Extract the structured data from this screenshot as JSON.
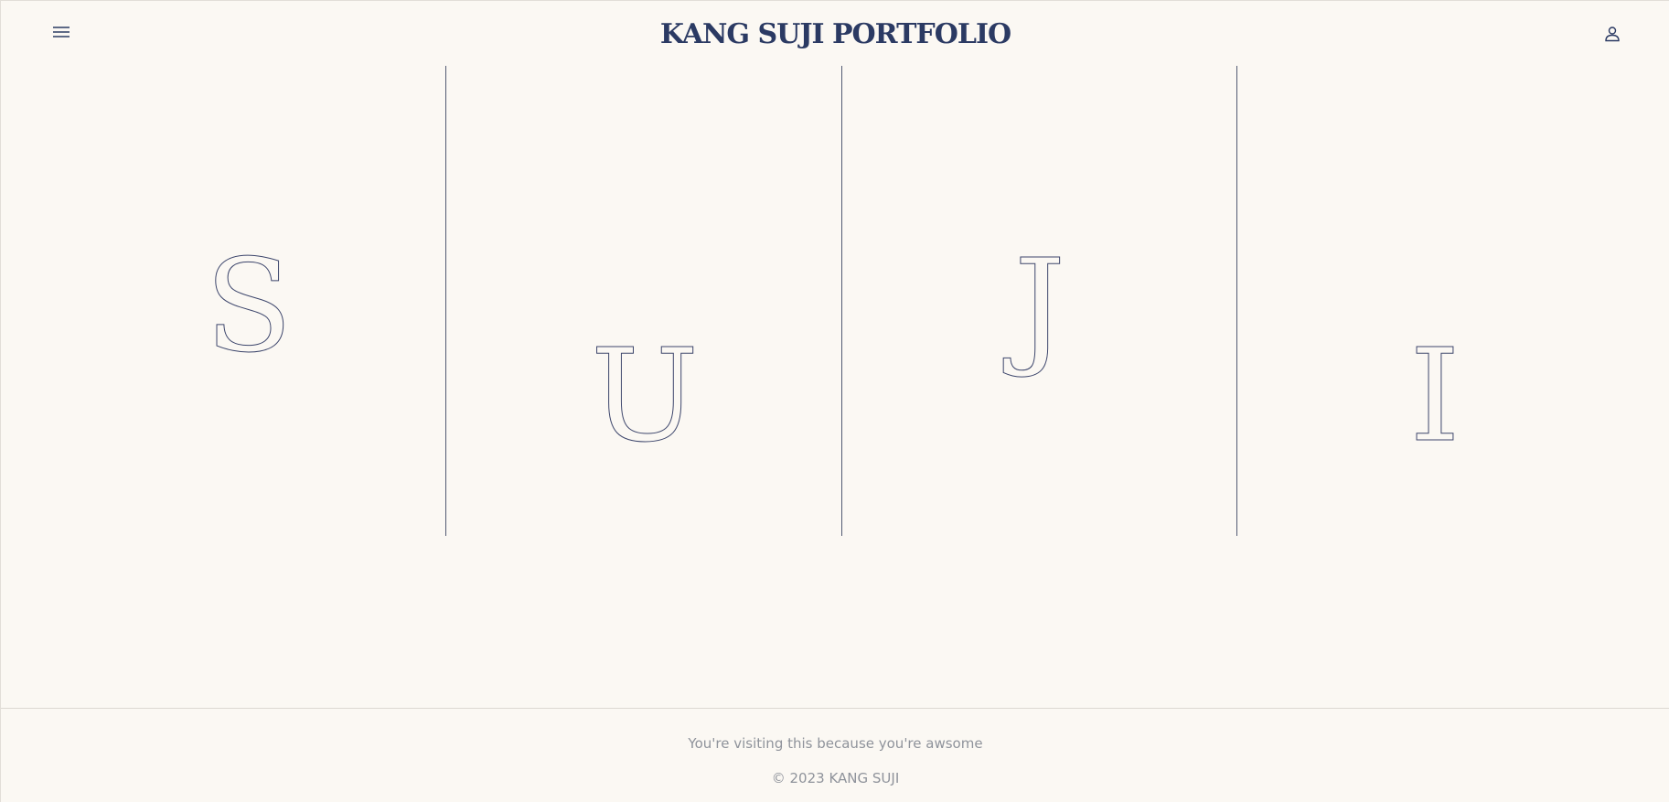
{
  "header": {
    "title": "KANG SUJI PORTFOLIO",
    "menu_icon": "hamburger-menu-icon",
    "user_icon": "user-icon"
  },
  "hero": {
    "letters": [
      "S",
      "U",
      "J",
      "I"
    ]
  },
  "footer": {
    "message": "You're visiting this because you're awsome",
    "copyright": "© 2023 KANG SUJI"
  },
  "colors": {
    "background": "#fbf8f3",
    "title": "#2b3a63",
    "outline": "#3c456b",
    "footer_text": "#8f939b"
  }
}
